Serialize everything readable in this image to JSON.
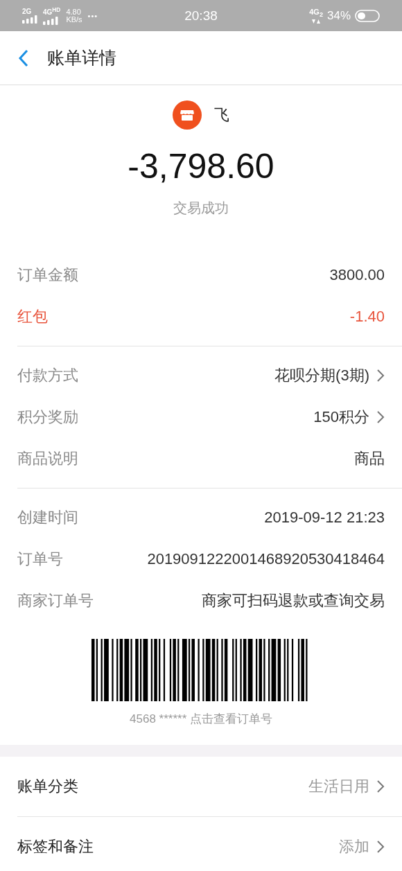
{
  "status_bar": {
    "signal_1_label": "2G",
    "signal_2_label": "4G$^{HD}$",
    "speed": "4.80",
    "speed_unit": "KB/s",
    "more": "•••",
    "time": "20:38",
    "network": "4G$_{2}$",
    "battery": "34%"
  },
  "header": {
    "title": "账单详情"
  },
  "merchant": {
    "name": "飞"
  },
  "amount": "-3,798.60",
  "status": "交易成功",
  "sections": [
    {
      "rows": [
        {
          "label": "订单金额",
          "value": "3800.00",
          "kind": "plain"
        },
        {
          "label": "红包",
          "value": "-1.40",
          "kind": "plain",
          "color": "#e8543c"
        }
      ]
    },
    {
      "rows": [
        {
          "label": "付款方式",
          "value": "花呗分期(3期)",
          "kind": "link"
        },
        {
          "label": "积分奖励",
          "value": "150积分",
          "kind": "link"
        },
        {
          "label": "商品说明",
          "value": "商品",
          "kind": "plain"
        }
      ]
    },
    {
      "rows": [
        {
          "label": "创建时间",
          "value": "2019-09-12 21:23",
          "kind": "plain"
        },
        {
          "label": "订单号",
          "value": "2019091222001468920530418464",
          "kind": "plain"
        },
        {
          "label": "商家订单号",
          "value": "商家可扫码退款或查询交易",
          "kind": "plain"
        }
      ]
    }
  ],
  "barcode": {
    "caption": "4568 ****** 点击查看订单号"
  },
  "actions": [
    {
      "label": "账单分类",
      "value": "生活日用",
      "kind": "link"
    },
    {
      "label": "标签和备注",
      "value": "添加",
      "kind": "link"
    }
  ]
}
